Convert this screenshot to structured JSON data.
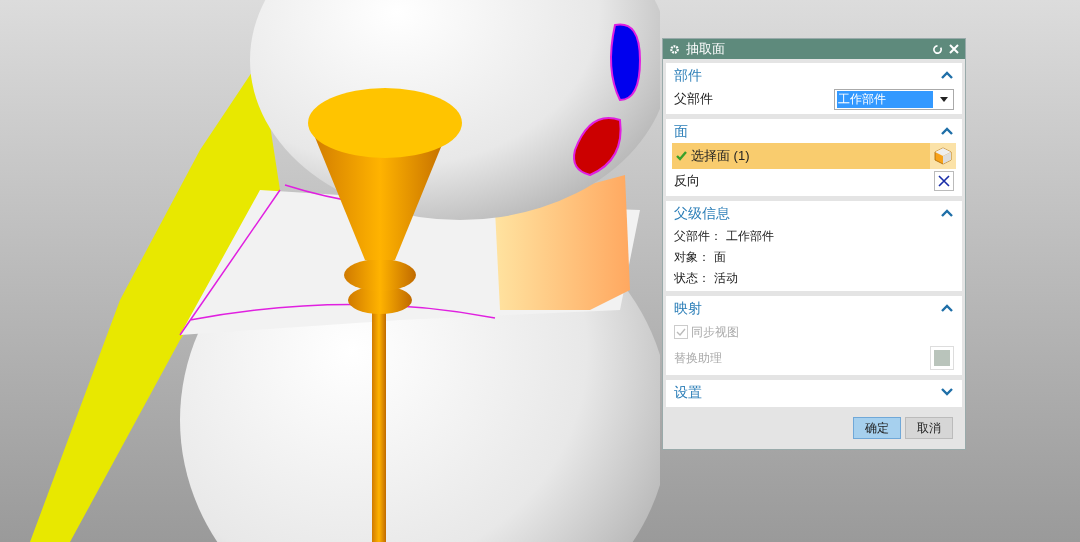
{
  "dialog": {
    "title": "抽取面",
    "sections": [
      {
        "title": "部件",
        "expanded": true,
        "rows": [
          {
            "kind": "dropdown",
            "label": "父部件",
            "value": "工作部件"
          }
        ]
      },
      {
        "title": "面",
        "expanded": true,
        "rows": [
          {
            "kind": "selection",
            "label": "选择面 (1)",
            "selected": true
          },
          {
            "kind": "action",
            "label": "反向"
          }
        ]
      },
      {
        "title": "父级信息",
        "expanded": true,
        "rows": [
          {
            "kind": "info",
            "label": "父部件：",
            "value": "工作部件"
          },
          {
            "kind": "info",
            "label": "对象：",
            "value": "面"
          },
          {
            "kind": "info",
            "label": "状态：",
            "value": "活动"
          }
        ]
      },
      {
        "title": "映射",
        "expanded": true,
        "rows": [
          {
            "kind": "checkbox",
            "label": "同步视图",
            "checked": true,
            "disabled": true
          },
          {
            "kind": "swatch",
            "label": "替换助理",
            "disabled": true
          }
        ]
      },
      {
        "title": "设置",
        "expanded": false
      }
    ],
    "buttons": [
      {
        "label": "确定",
        "selected": true
      },
      {
        "label": "取消",
        "selected": false
      }
    ]
  }
}
